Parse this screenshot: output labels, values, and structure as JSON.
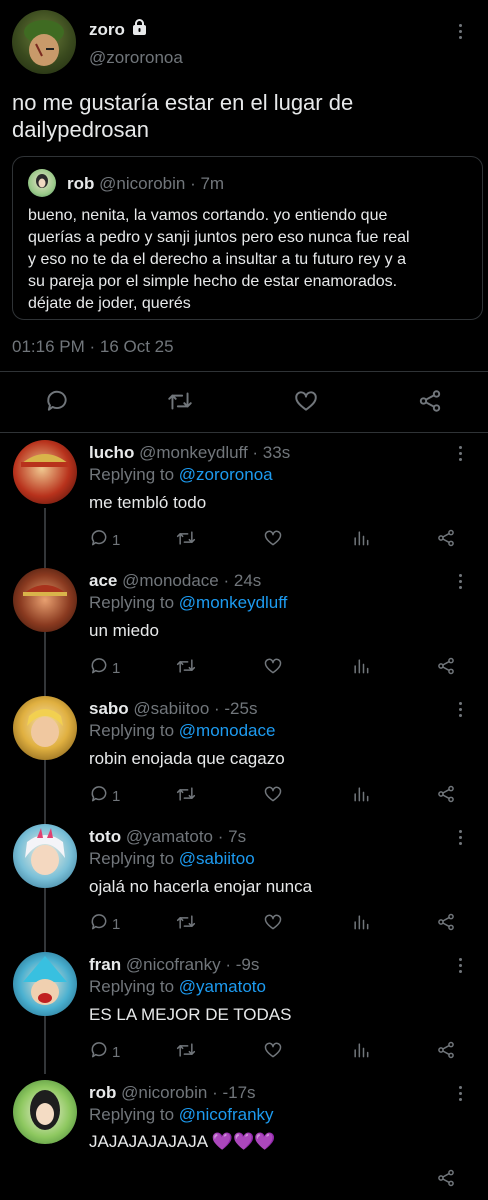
{
  "main_tweet": {
    "name": "zoro",
    "handle": "@zororonoa",
    "text_line1": "no me gustaría estar en el lugar de",
    "text_line2": "dailypedrosan",
    "timestamp": "01:16 PM · 16 Oct 25",
    "quote": {
      "name": "rob",
      "handle_time": "@nicorobin · 7m",
      "lines": [
        "bueno, nenita, la vamos cortando. yo entiendo que",
        "querías a pedro y sanji juntos pero eso nunca fue real",
        "y eso no te da el derecho a insultar a tu futuro rey y a",
        "su pareja por el simple hecho de estar enamorados.",
        "déjate de joder, querés"
      ]
    }
  },
  "replies": [
    {
      "name": "lucho",
      "handle_time": "@monkeydluff · 33s",
      "replying_prefix": "Replying to",
      "replying_to": "@zororonoa",
      "text": "me tembló todo",
      "reply_count": "1",
      "avatar_color": "#8b1a12"
    },
    {
      "name": "ace",
      "handle_time": "@monodace · 24s",
      "replying_prefix": "Replying to",
      "replying_to": "@monkeydluff",
      "text": "un miedo",
      "reply_count": "1",
      "avatar_color": "#5a2a1a"
    },
    {
      "name": "sabo",
      "handle_time": "@sabiitoo · -25s",
      "replying_prefix": "Replying to",
      "replying_to": "@monodace",
      "text": "robin enojada que cagazo",
      "reply_count": "1",
      "avatar_color": "#d8a935"
    },
    {
      "name": "toto",
      "handle_time": "@yamatoto · 7s",
      "replying_prefix": "Replying to",
      "replying_to": "@sabiitoo",
      "text": "ojalá no hacerla enojar nunca",
      "reply_count": "1",
      "avatar_color": "#4ea8c8"
    },
    {
      "name": "fran",
      "handle_time": "@nicofranky · -9s",
      "replying_prefix": "Replying to",
      "replying_to": "@yamatoto",
      "text": "ES LA MEJOR DE TODAS",
      "reply_count": "1",
      "avatar_color": "#2b8fb0"
    },
    {
      "name": "rob",
      "handle_time": "@nicorobin · -17s",
      "replying_prefix": "Replying to",
      "replying_to": "@nicofranky",
      "text": "JAJAJAJAJAJA 💜💜💜",
      "reply_count": "",
      "avatar_color": "#6fb04a"
    }
  ]
}
